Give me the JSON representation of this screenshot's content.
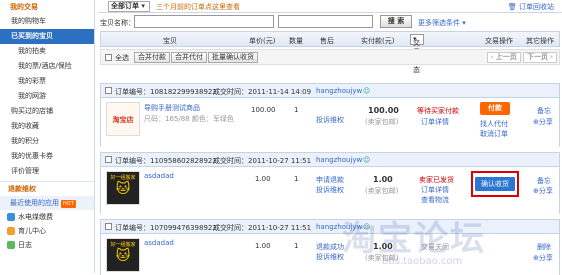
{
  "sidebar": {
    "title": "我的交易",
    "cart": "我的购物车",
    "bought": "已买到的宝贝",
    "sub": [
      "我的拍卖",
      "我的票/酒店/保险",
      "我的彩票",
      "我的网游"
    ],
    "items": [
      "购买过的店铺",
      "我的收藏",
      "我的积分",
      "我的优惠卡券",
      "评价管理"
    ],
    "refund": "退款维权",
    "recent": "最近使用的应用",
    "hot": "HOT",
    "apps": [
      "水电煤缴费",
      "育儿中心",
      "日志"
    ]
  },
  "tabbar": {
    "select": "全部订单",
    "marquee": "三个月前的订单点这里查看",
    "recycle": "订单回收站"
  },
  "search": {
    "label": "宝贝名称：",
    "button": "搜 索",
    "more": "更多筛选条件"
  },
  "table_headers": [
    "宝贝",
    "单价(元)",
    "数量",
    "售后",
    "实付款(元)",
    "交易状态",
    "交易操作",
    "其它操作"
  ],
  "actions": {
    "select_all": "全选",
    "merge_pay": "合并付款",
    "merge_proxy": "合并代付",
    "batch_confirm": "批量确认收货",
    "prev": "上一页",
    "next": "下一页"
  },
  "orders": [
    {
      "order_no": "订单编号：108182299938922",
      "time": "成交时间：2011-11-14 14:09",
      "seller": "hangzhoujyw",
      "product": "导购手册测试商品",
      "props": "尺码：165/88  颜色：军绿色",
      "logo_text": "淘宝店",
      "price": "100.00",
      "qty": "1",
      "aftersale": "投诉维权",
      "total": "100.00",
      "total_note": "(卖家包邮)",
      "status": "等待买家付款",
      "status_link": "订单详情",
      "op_btn": "付款",
      "op_links": [
        "找人代付",
        "取消订单"
      ],
      "other": [
        "备忘",
        "分享"
      ]
    },
    {
      "order_no": "订单编号：110958602828922",
      "time": "成交时间：2011-10-27 11:51",
      "seller": "hangzhoujyw",
      "product": "asdadad",
      "logo_text": "好一组搬家",
      "price": "1.00",
      "qty": "1",
      "aftersale": "申请退款",
      "aftersale2": "投诉维权",
      "total": "1.00",
      "total_note": "(卖家包邮)",
      "status": "卖家已发货",
      "status_link": "订单详情",
      "status_link2": "查看物流",
      "op_btn": "确认收货",
      "other": [
        "备忘",
        "分享"
      ]
    },
    {
      "order_no": "订单编号：107099476398922",
      "time": "成交时间：2011-10-27 11:51",
      "seller": "hangzhoujyw",
      "product": "asdadad",
      "logo_text": "好一组搬家",
      "price": "1.00",
      "qty": "1",
      "aftersale": "退款成功",
      "aftersale2": "投诉维权",
      "total": "1.00",
      "total_note": "(卖家包邮)",
      "status": "交易关闭",
      "op_btn": "",
      "other": [
        "删除",
        "分享"
      ]
    }
  ],
  "watermark": {
    "big": "淘宝论坛",
    "small": "bbs.taobao.com"
  },
  "colors": {
    "accent": "#2d6fc0",
    "orange": "#ff6600",
    "red": "#cc0000"
  }
}
